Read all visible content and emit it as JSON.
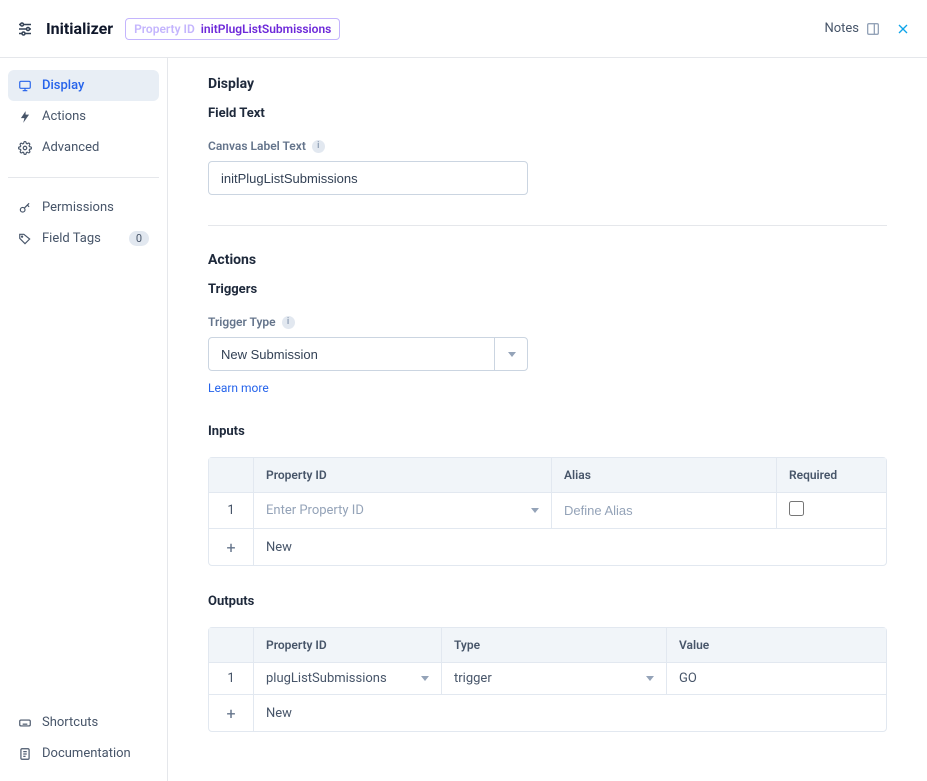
{
  "header": {
    "title": "Initializer",
    "propertyIdLabel": "Property ID",
    "propertyIdValue": "initPlugListSubmissions",
    "notesLabel": "Notes"
  },
  "sidebar": {
    "display": "Display",
    "actions": "Actions",
    "advanced": "Advanced",
    "permissions": "Permissions",
    "fieldTags": "Field Tags",
    "fieldTagsCount": "0",
    "shortcuts": "Shortcuts",
    "documentation": "Documentation"
  },
  "display": {
    "sectionTitle": "Display",
    "fieldText": "Field Text",
    "canvasLabel": "Canvas Label Text",
    "canvasValue": "initPlugListSubmissions"
  },
  "actions": {
    "sectionTitle": "Actions",
    "triggers": "Triggers",
    "triggerTypeLabel": "Trigger Type",
    "triggerTypeValue": "New Submission",
    "learnMore": "Learn more",
    "inputs": {
      "title": "Inputs",
      "headers": {
        "propertyId": "Property ID",
        "alias": "Alias",
        "required": "Required"
      },
      "row1": {
        "num": "1",
        "propertyPlaceholder": "Enter Property ID",
        "aliasPlaceholder": "Define Alias"
      },
      "newLabel": "New"
    },
    "outputs": {
      "title": "Outputs",
      "headers": {
        "propertyId": "Property ID",
        "type": "Type",
        "value": "Value"
      },
      "row1": {
        "num": "1",
        "propertyId": "plugListSubmissions",
        "type": "trigger",
        "value": "GO"
      },
      "newLabel": "New"
    }
  }
}
